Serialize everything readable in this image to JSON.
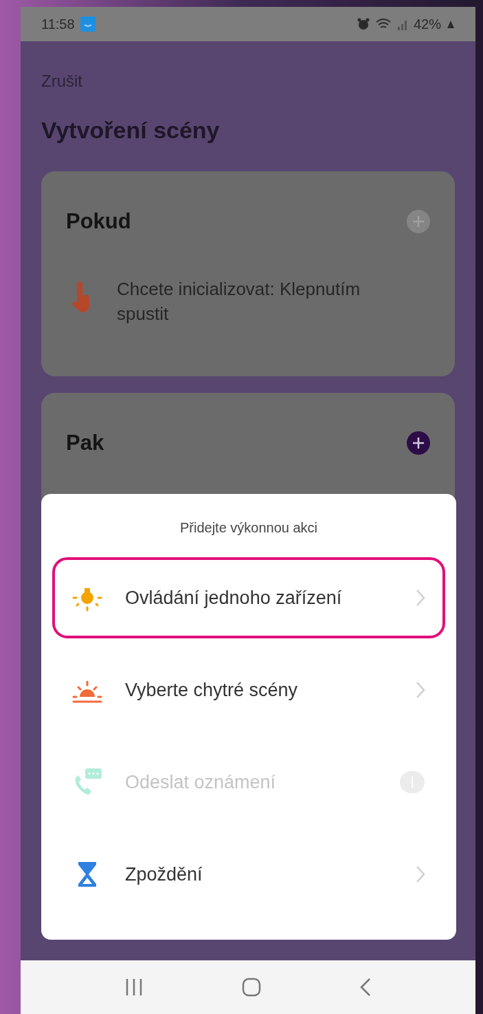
{
  "status_bar": {
    "time": "11:58",
    "battery": "42%"
  },
  "header": {
    "cancel": "Zrušit",
    "title": "Vytvoření scény"
  },
  "sections": [
    {
      "title": "Pokud",
      "add_enabled": false,
      "items": [
        {
          "kind": "tap",
          "text": "Chcete inicializovat: Klepnutím spustit"
        }
      ]
    },
    {
      "title": "Pak",
      "add_enabled": true
    }
  ],
  "sheet": {
    "title": "Přidejte výkonnou akci",
    "options": [
      {
        "kind": "device",
        "label": "Ovládání jednoho zařízení",
        "selected": true,
        "disabled": false
      },
      {
        "kind": "scene",
        "label": "Vyberte chytré scény",
        "selected": false,
        "disabled": false
      },
      {
        "kind": "notify",
        "label": "Odeslat oznámení",
        "selected": false,
        "disabled": true
      },
      {
        "kind": "delay",
        "label": "Zpoždění",
        "selected": false,
        "disabled": false
      }
    ]
  }
}
